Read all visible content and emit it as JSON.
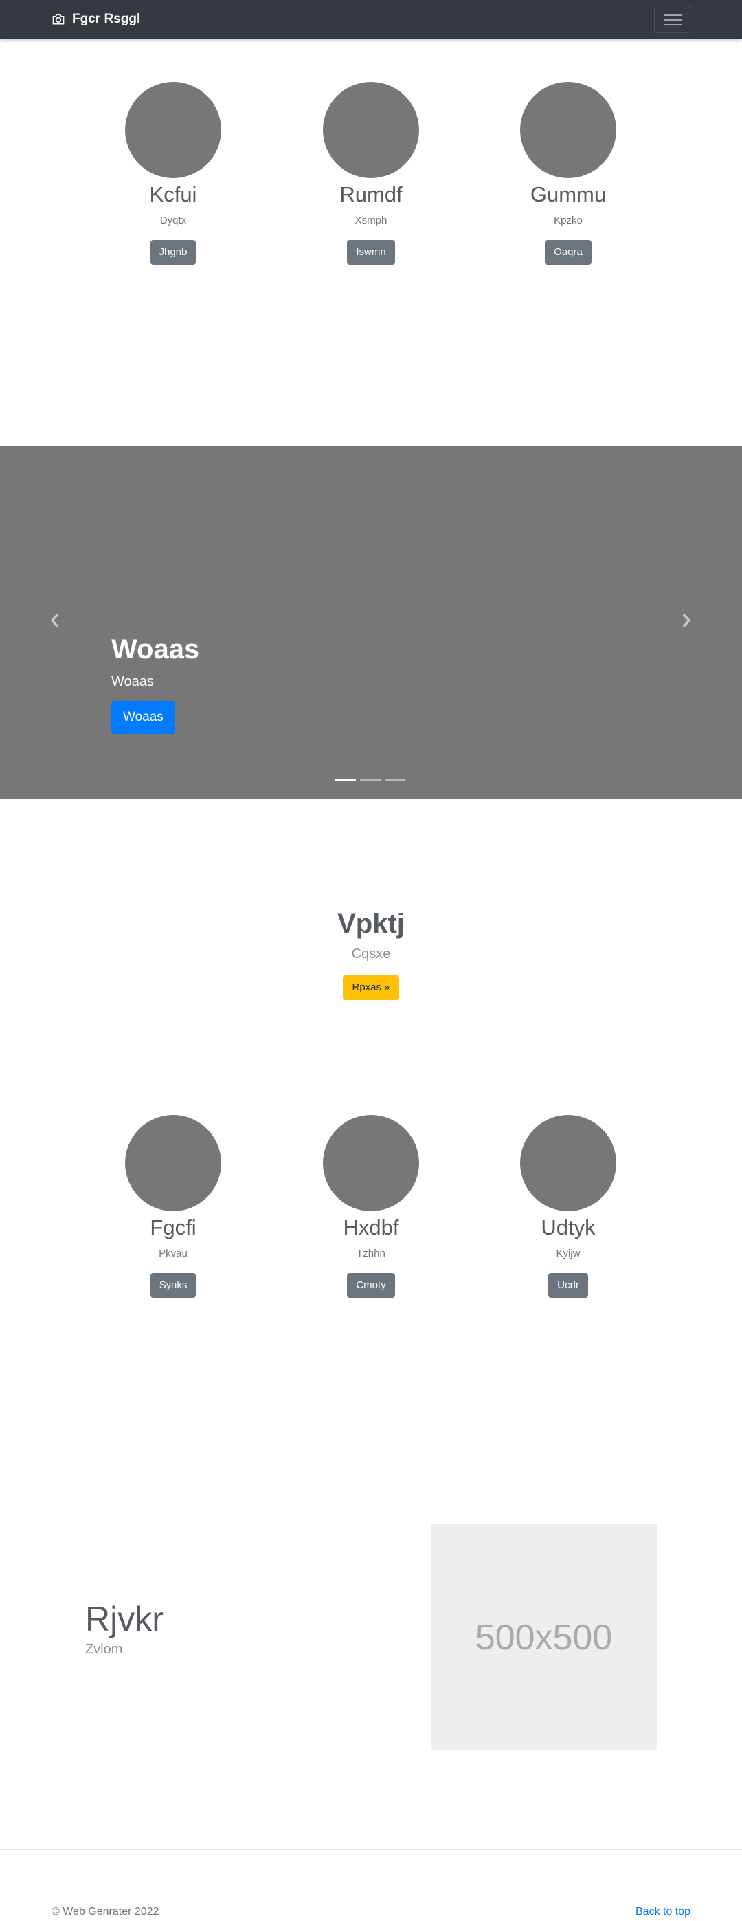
{
  "navbar": {
    "brand": "Fgcr Rsggl",
    "brand_icon": "camera-icon",
    "toggler_icon": "hamburger-icon"
  },
  "marketing_top": [
    {
      "heading": "Kcfui",
      "text": "Dyqtx",
      "button": "Jhgnb"
    },
    {
      "heading": "Rumdf",
      "text": "Xsmph",
      "button": "Iswmn"
    },
    {
      "heading": "Gummu",
      "text": "Kpzko",
      "button": "Oaqra"
    }
  ],
  "carousel": {
    "heading": "Woaas",
    "text": "Woaas",
    "button": "Woaas",
    "slide_count": 3,
    "active_slide": 1,
    "prev_icon": "chevron-left-icon",
    "next_icon": "chevron-right-icon"
  },
  "hero": {
    "heading": "Vpktj",
    "text": "Cqsxe",
    "button": "Rpxas »"
  },
  "marketing_bottom": [
    {
      "heading": "Fgcfi",
      "text": "Pkvau",
      "button": "Syaks"
    },
    {
      "heading": "Hxdbf",
      "text": "Tzhhn",
      "button": "Cmoty"
    },
    {
      "heading": "Udtyk",
      "text": "Kyijw",
      "button": "Ucrlr"
    }
  ],
  "featurette": {
    "heading": "Rjvkr",
    "text": "Zvlom",
    "image_label": "500x500"
  },
  "footer": {
    "copyright": "© Web Genrater 2022",
    "back_to_top": "Back to top"
  },
  "colors": {
    "navbar_bg": "#343a40",
    "primary": "#007bff",
    "secondary": "#6c757d",
    "warning": "#ffc107",
    "placeholder_gray": "#777777"
  }
}
